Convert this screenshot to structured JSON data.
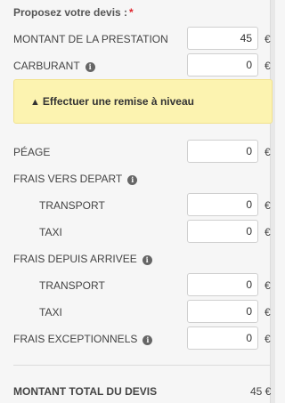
{
  "form": {
    "title": "Proposez votre devis :",
    "required_mark": "*",
    "currency": "€",
    "alert_text": "Effectuer une remise à niveau",
    "fields": {
      "montant": {
        "label": "MONTANT DE LA PRESTATION",
        "value": "45"
      },
      "carburant": {
        "label": "CARBURANT",
        "value": "0"
      },
      "peage": {
        "label": "PÉAGE",
        "value": "0"
      },
      "frais_vers_depart": {
        "label": "FRAIS VERS DEPART"
      },
      "depart_transport": {
        "label": "TRANSPORT",
        "value": "0"
      },
      "depart_taxi": {
        "label": "TAXI",
        "value": "0"
      },
      "frais_depuis_arrivee": {
        "label": "FRAIS DEPUIS ARRIVEE"
      },
      "arrivee_transport": {
        "label": "TRANSPORT",
        "value": "0"
      },
      "arrivee_taxi": {
        "label": "TAXI",
        "value": "0"
      },
      "exceptionnels": {
        "label": "FRAIS EXCEPTIONNELS",
        "value": "0"
      }
    },
    "total": {
      "label": "MONTANT TOTAL DU DEVIS",
      "value": "45 €"
    }
  },
  "colors": {
    "alert_bg": "#fcf3b0",
    "required": "#e0262e",
    "background": "#f6f6f6"
  },
  "icons": {
    "info": "info-circle-icon",
    "warning": "warning-triangle-icon"
  }
}
